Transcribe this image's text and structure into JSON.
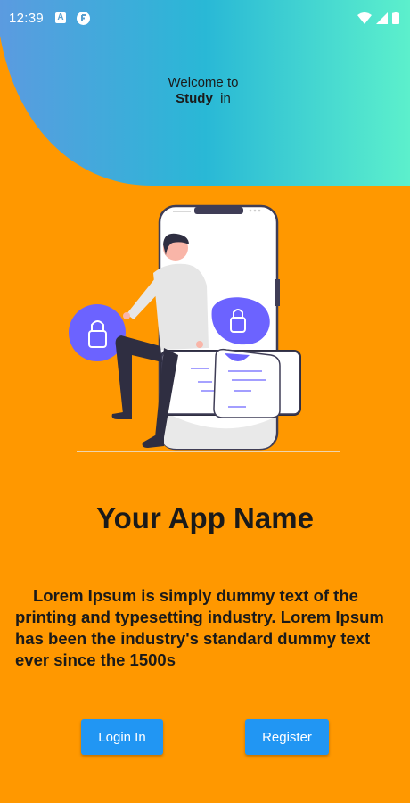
{
  "status_bar": {
    "time": "12:39",
    "left_icons": [
      "a-notification-icon",
      "f-notification-icon"
    ],
    "right_icons": [
      "wifi-icon",
      "signal-icon",
      "battery-icon"
    ]
  },
  "header": {
    "welcome_line": "Welcome to",
    "brand": "Study",
    "brand_suffix": "in",
    "gradient_colors": [
      "#5B9BE0",
      "#29B8D6",
      "#5CF0CC"
    ]
  },
  "illustration": {
    "name": "secure-login-illustration",
    "accent_color": "#6C63FF"
  },
  "main": {
    "app_name": "Your App Name",
    "description": "Lorem Ipsum is simply dummy text of the printing and typesetting industry. Lorem Ipsum has been the industry's standard dummy text ever since the 1500s"
  },
  "actions": {
    "login_label": "Login In",
    "register_label": "Register"
  },
  "colors": {
    "background": "#FF9800",
    "button": "#2196F3"
  }
}
